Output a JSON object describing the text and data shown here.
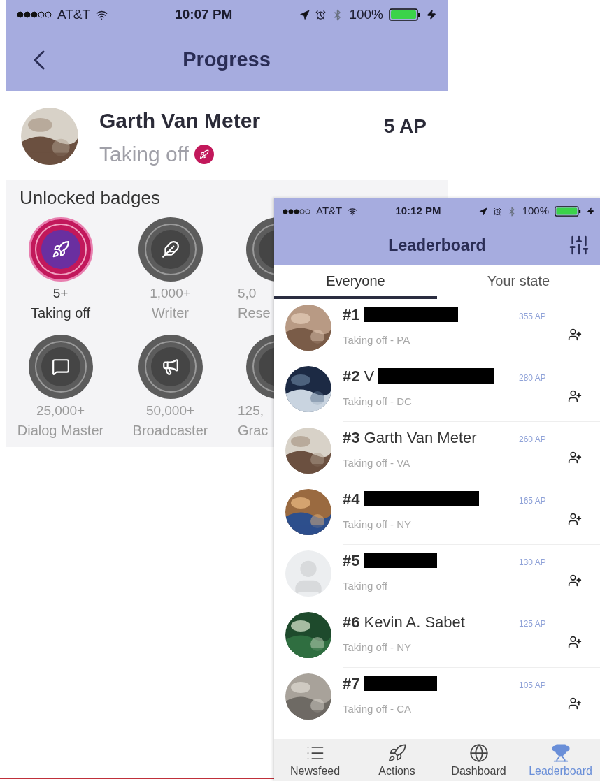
{
  "progress_screen": {
    "status_bar": {
      "carrier": "AT&T",
      "time": "10:07 PM",
      "battery": "100%"
    },
    "nav_bar": {
      "title": "Progress"
    },
    "profile": {
      "name": "Garth Van Meter",
      "points": "5 AP",
      "level": "Taking off"
    },
    "badges_section": {
      "title": "Unlocked badges",
      "badges": [
        {
          "threshold": "5+",
          "name": "Taking off",
          "unlocked": true
        },
        {
          "threshold": "1,000+",
          "name": "Writer",
          "unlocked": false
        },
        {
          "threshold": "5,0",
          "name": "Rese",
          "unlocked": false
        },
        {
          "threshold": "25,000+",
          "name": "Dialog Master",
          "unlocked": false
        },
        {
          "threshold": "50,000+",
          "name": "Broadcaster",
          "unlocked": false
        },
        {
          "threshold": "125,",
          "name": "Grac",
          "unlocked": false
        }
      ]
    }
  },
  "leaderboard_screen": {
    "status_bar": {
      "carrier": "AT&T",
      "time": "10:12 PM",
      "battery": "100%"
    },
    "nav_bar": {
      "title": "Leaderboard"
    },
    "tabs": [
      {
        "label": "Everyone",
        "selected": true
      },
      {
        "label": "Your state",
        "selected": false
      }
    ],
    "rows": [
      {
        "rank": "#1",
        "redacted": true,
        "subtitle": "Taking off - PA",
        "points": "355 AP"
      },
      {
        "rank": "#2",
        "name": "V",
        "redacted": true,
        "subtitle": "Taking off - DC",
        "points": "280 AP"
      },
      {
        "rank": "#3",
        "name": "Garth Van Meter",
        "redacted": false,
        "subtitle": "Taking off - VA",
        "points": "260 AP"
      },
      {
        "rank": "#4",
        "redacted": true,
        "subtitle": "Taking off - NY",
        "points": "165 AP"
      },
      {
        "rank": "#5",
        "redacted": true,
        "subtitle": "Taking off",
        "points": "130 AP",
        "avatar": {
          "kind": "placeholder"
        }
      },
      {
        "rank": "#6",
        "name": "Kevin A. Sabet",
        "redacted": false,
        "subtitle": "Taking off - NY",
        "points": "125 AP"
      },
      {
        "rank": "#7",
        "redacted": true,
        "subtitle": "Taking off - CA",
        "points": "105 AP"
      }
    ],
    "tab_bar": [
      {
        "label": "Newsfeed",
        "selected": false
      },
      {
        "label": "Actions",
        "selected": false
      },
      {
        "label": "Dashboard",
        "selected": false
      },
      {
        "label": "Leaderboard",
        "selected": true
      }
    ]
  }
}
